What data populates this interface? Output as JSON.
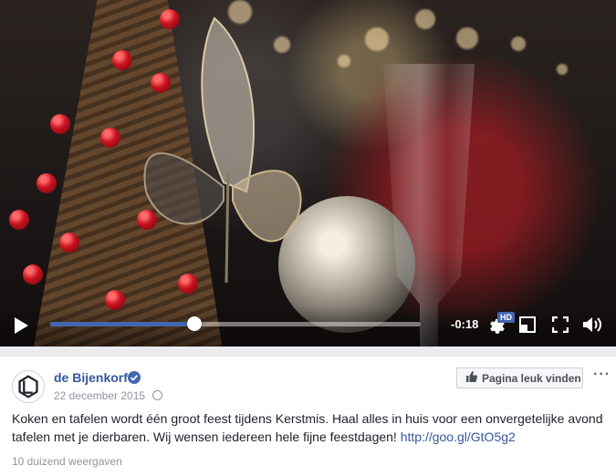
{
  "video": {
    "time_remaining": "-0:18",
    "progress": 0.39,
    "quality_badge": "HD",
    "icons": [
      "play-icon",
      "settings-gear-icon",
      "picture-in-picture-icon",
      "fullscreen-icon",
      "volume-icon"
    ]
  },
  "post": {
    "page_name": "de Bijenkorf",
    "date": "22 december 2015",
    "like_page_label": "Pagina leuk vinden",
    "more_label": "···",
    "text": "Koken en tafelen wordt één groot feest tijdens Kerstmis. Haal alles in huis voor een onvergetelijke avond tafelen met je dierbaren. Wij wensen iedereen hele fijne feestdagen! ",
    "link": "http://goo.gl/GtO5g2",
    "views": "10 duizend weergaven"
  },
  "colors": {
    "accent": "#4267b2",
    "link": "#365899",
    "meta": "#90949c"
  }
}
